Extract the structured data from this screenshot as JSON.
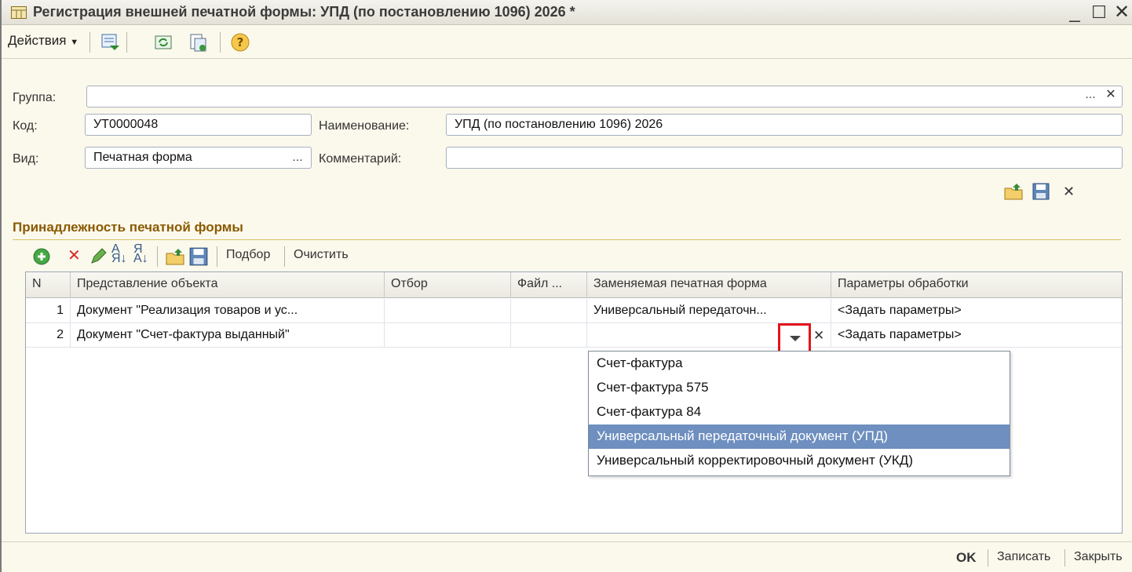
{
  "window": {
    "title": "Регистрация внешней печатной формы: УПД (по постановлению 1096) 2026 *"
  },
  "toolbar": {
    "actions_label": "Действия"
  },
  "form": {
    "group_label": "Группа:",
    "group_value": "",
    "code_label": "Код:",
    "code_value": "УТ0000048",
    "name_label": "Наименование:",
    "name_value": "УПД (по постановлению 1096) 2026",
    "kind_label": "Вид:",
    "kind_value": "Печатная форма",
    "comment_label": "Комментарий:",
    "comment_value": ""
  },
  "section": {
    "title": "Принадлежность печатной формы",
    "select_label": "Подбор",
    "clear_label": "Очистить"
  },
  "table": {
    "columns": [
      "N",
      "Представление объекта",
      "Отбор",
      "Файл ...",
      "Заменяемая печатная форма",
      "Параметры обработки"
    ],
    "rows": [
      {
        "n": "1",
        "object": "Документ \"Реализация товаров и ус...",
        "filter": "",
        "file": "",
        "replaced": "Универсальный передаточн...",
        "params": "<Задать параметры>"
      },
      {
        "n": "2",
        "object": "Документ \"Счет-фактура выданный\"",
        "filter": "",
        "file": "",
        "replaced": "",
        "params": "<Задать параметры>"
      }
    ]
  },
  "dropdown": {
    "options": [
      "Счет-фактура",
      "Счет-фактура 575",
      "Счет-фактура 84",
      "Универсальный передаточный документ (УПД)",
      "Универсальный корректировочный документ (УКД)"
    ],
    "selected_index": 3
  },
  "footer": {
    "ok_label": "OK",
    "save_label": "Записать",
    "close_label": "Закрыть"
  },
  "colors": {
    "highlight": "#6e8fbf",
    "callout": "#e4141b",
    "section_title": "#8a5a00"
  }
}
